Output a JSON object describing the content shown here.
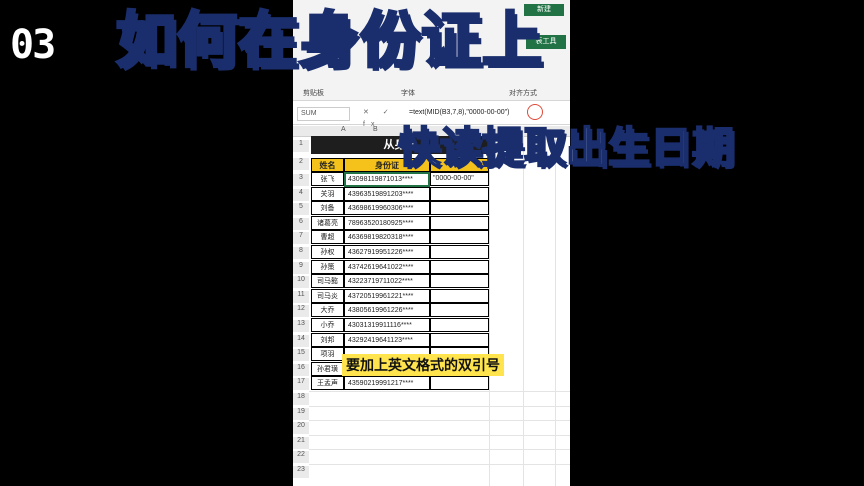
{
  "episode": "03",
  "title": "如何在身份证上",
  "subtitle": "快读提取出生日期",
  "caption": "要加上英文格式的双引号",
  "excel": {
    "ribbon": {
      "tab_new": "新建",
      "tab_tools": "表工具",
      "group_clipboard": "剪贴板",
      "group_font": "字体",
      "group_align": "对齐方式"
    },
    "name_box": "SUM",
    "fx_buttons": "✕ ✓ fx",
    "formula": "=text(MID(B3,7,8),\"0000-00-00\")",
    "columns": [
      "A",
      "B"
    ],
    "sheet_title": "从身份",
    "headers": [
      "姓名",
      "身份证"
    ],
    "editing_text": "\"0000-00-00\"",
    "rows": [
      {
        "n": "3",
        "name": "张飞",
        "id": "43098119871013****"
      },
      {
        "n": "4",
        "name": "关羽",
        "id": "43963519891203****"
      },
      {
        "n": "5",
        "name": "刘备",
        "id": "43698619960306****"
      },
      {
        "n": "6",
        "name": "诸葛亮",
        "id": "78963520180925****"
      },
      {
        "n": "7",
        "name": "曹超",
        "id": "46369819820318****"
      },
      {
        "n": "8",
        "name": "孙权",
        "id": "43627919951226****"
      },
      {
        "n": "9",
        "name": "孙策",
        "id": "43742619641022****"
      },
      {
        "n": "10",
        "name": "司马懿",
        "id": "43223719711022****"
      },
      {
        "n": "11",
        "name": "司马炎",
        "id": "43720519961221****"
      },
      {
        "n": "12",
        "name": "大乔",
        "id": "43805619961226****"
      },
      {
        "n": "13",
        "name": "小乔",
        "id": "43031319911116****"
      },
      {
        "n": "14",
        "name": "刘邦",
        "id": "43292419641123****"
      },
      {
        "n": "15",
        "name": "项羽",
        "id": ""
      },
      {
        "n": "16",
        "name": "孙君璜",
        "id": ""
      },
      {
        "n": "17",
        "name": "王孟声",
        "id": "43590219991217****"
      }
    ],
    "row_numbers": [
      "1",
      "2"
    ],
    "tail_rows": [
      "18",
      "19",
      "20",
      "21",
      "22",
      "23"
    ]
  }
}
